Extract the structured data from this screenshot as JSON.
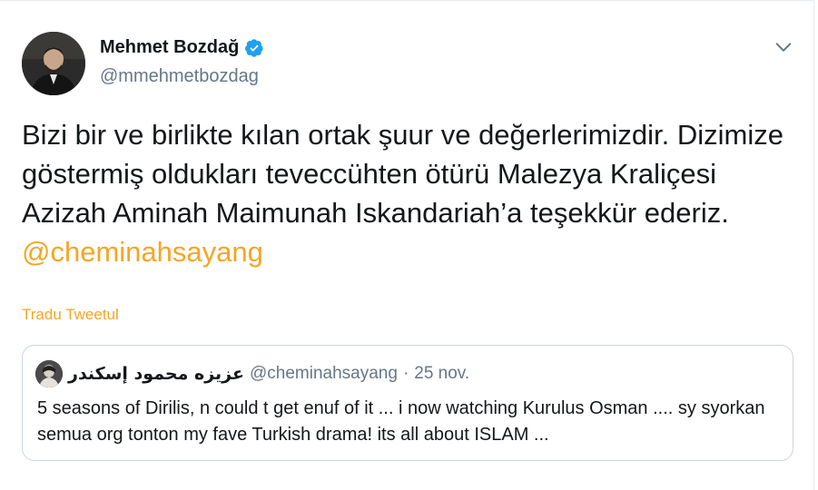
{
  "author": {
    "name": "Mehmet Bozdağ",
    "handle": "@mmehmetbozdag",
    "verified": true
  },
  "tweet": {
    "text": "Bizi bir ve birlikte kılan ortak şuur ve değerlerimizdir. Dizimize göstermiş oldukları teveccühten ötürü Malezya Kraliçesi Azizah Aminah Maimunah Iskandariah’a teşekkür ederiz.",
    "mention": "@cheminahsayang"
  },
  "translate_label": "Tradu Tweetul",
  "quoted": {
    "name": "عزيزه محمود إسكندر",
    "handle": "@cheminahsayang",
    "separator": "·",
    "date": "25 nov.",
    "text": "5 seasons of Dirilis, n could t get enuf of it ... i now watching Kurulus Osman .... sy syorkan semua org tonton my fave Turkish drama! its all about ISLAM ..."
  },
  "icons": {
    "verified": "verified-badge-icon",
    "menu": "chevron-down-icon"
  },
  "colors": {
    "accent": "#f5a623",
    "verified": "#1da1f2",
    "muted": "#657786",
    "border": "#ccd6dd"
  }
}
